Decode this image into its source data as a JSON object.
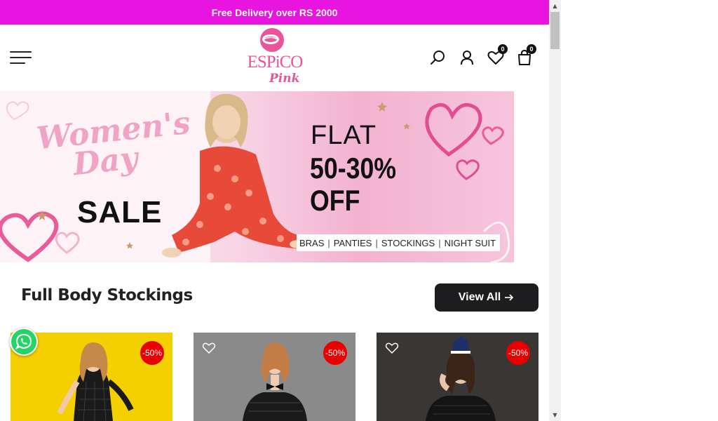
{
  "announcement": {
    "text": "Free Delivery over RS 2000"
  },
  "header": {
    "logo": {
      "brand": "ESPiCO",
      "sub": "Pink"
    },
    "wishlist_count": "0",
    "cart_count": "0",
    "icons": [
      "menu-icon",
      "search-icon",
      "user-icon",
      "heart-icon",
      "bag-icon"
    ]
  },
  "banner": {
    "script_line1": "Women's",
    "script_line2": "Day",
    "sale": "SALE",
    "flat": "FLAT",
    "discount": "50-30%",
    "off": "OFF",
    "categories": [
      "BRAS",
      "PANTIES",
      "STOCKINGS",
      "NIGHT SUIT"
    ]
  },
  "section": {
    "title": "Full Body Stockings",
    "view_all": "View All"
  },
  "products": [
    {
      "badge": "-50%",
      "bg": "#f5d000"
    },
    {
      "badge": "-50%",
      "bg": "#8f8f8f"
    },
    {
      "badge": "-50%",
      "bg": "#2a2a2a"
    }
  ],
  "colors": {
    "announcement_bg": "#e815e1",
    "brand_pink": "#e8559b",
    "sale_red": "#e80000",
    "button_dark": "#1d1d1f",
    "whatsapp_green": "#25d366"
  }
}
